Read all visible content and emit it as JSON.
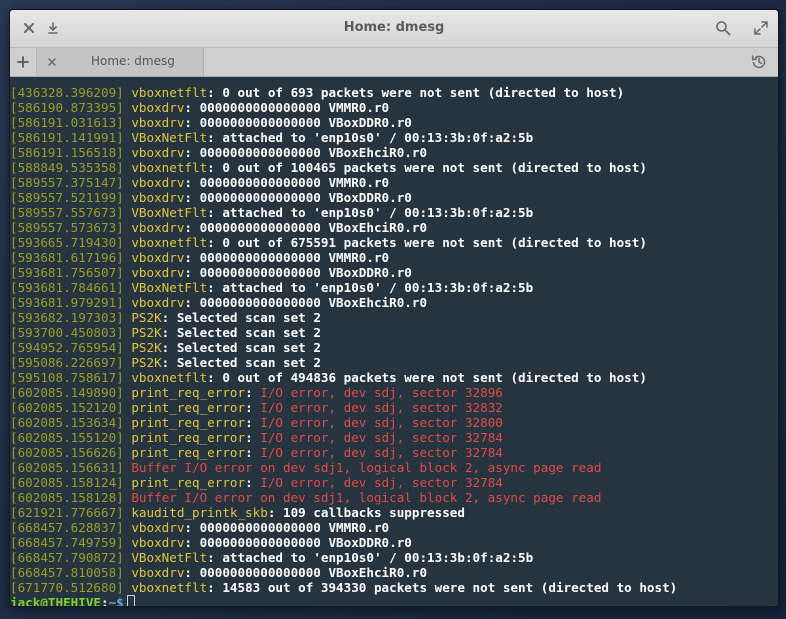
{
  "window": {
    "title": "Home: dmesg"
  },
  "tabs": [
    {
      "label": "Home: dmesg"
    }
  ],
  "icons": {
    "close": "close-icon",
    "download": "download-icon",
    "search": "search-icon",
    "maximize": "maximize-icon",
    "add_tab": "plus-icon",
    "tab_close": "close-icon",
    "history": "history-icon"
  },
  "colors": {
    "timestamp": "#9c9c29",
    "module": "#e0c63f",
    "message": "#ffffff",
    "error": "#e04a48",
    "prompt_user": "#7fd12e",
    "prompt_path": "#5fa8e0",
    "terminal_bg": "#26343f"
  },
  "terminal": {
    "lines": [
      {
        "ts": "[436328.396209]",
        "mod": "vboxnetflt",
        "sep": ": ",
        "msg": "0 out of 693 packets were not sent (directed to host)"
      },
      {
        "ts": "[586190.873395]",
        "mod": "vboxdrv",
        "sep": ": ",
        "msg": "0000000000000000 VMMR0.r0"
      },
      {
        "ts": "[586191.031613]",
        "mod": "vboxdrv",
        "sep": ": ",
        "msg": "0000000000000000 VBoxDDR0.r0"
      },
      {
        "ts": "[586191.141991]",
        "mod": "VBoxNetFlt",
        "sep": ": ",
        "msg": "attached to 'enp10s0' / 00:13:3b:0f:a2:5b"
      },
      {
        "ts": "[586191.156518]",
        "mod": "vboxdrv",
        "sep": ": ",
        "msg": "0000000000000000 VBoxEhciR0.r0"
      },
      {
        "ts": "[588849.535358]",
        "mod": "vboxnetflt",
        "sep": ": ",
        "msg": "0 out of 100465 packets were not sent (directed to host)"
      },
      {
        "ts": "[589557.375147]",
        "mod": "vboxdrv",
        "sep": ": ",
        "msg": "0000000000000000 VMMR0.r0"
      },
      {
        "ts": "[589557.521199]",
        "mod": "vboxdrv",
        "sep": ": ",
        "msg": "0000000000000000 VBoxDDR0.r0"
      },
      {
        "ts": "[589557.557673]",
        "mod": "VBoxNetFlt",
        "sep": ": ",
        "msg": "attached to 'enp10s0' / 00:13:3b:0f:a2:5b"
      },
      {
        "ts": "[589557.573673]",
        "mod": "vboxdrv",
        "sep": ": ",
        "msg": "0000000000000000 VBoxEhciR0.r0"
      },
      {
        "ts": "[593665.719430]",
        "mod": "vboxnetflt",
        "sep": ": ",
        "msg": "0 out of 675591 packets were not sent (directed to host)"
      },
      {
        "ts": "[593681.617196]",
        "mod": "vboxdrv",
        "sep": ": ",
        "msg": "0000000000000000 VMMR0.r0"
      },
      {
        "ts": "[593681.756507]",
        "mod": "vboxdrv",
        "sep": ": ",
        "msg": "0000000000000000 VBoxDDR0.r0"
      },
      {
        "ts": "[593681.784661]",
        "mod": "VBoxNetFlt",
        "sep": ": ",
        "msg": "attached to 'enp10s0' / 00:13:3b:0f:a2:5b"
      },
      {
        "ts": "[593681.979291]",
        "mod": "vboxdrv",
        "sep": ": ",
        "msg": "0000000000000000 VBoxEhciR0.r0"
      },
      {
        "ts": "[593682.197303]",
        "mod": "PS2K",
        "sep": ": ",
        "msg": "Selected scan set 2"
      },
      {
        "ts": "[593700.450803]",
        "mod": "PS2K",
        "sep": ": ",
        "msg": "Selected scan set 2"
      },
      {
        "ts": "[594952.765954]",
        "mod": "PS2K",
        "sep": ": ",
        "msg": "Selected scan set 2"
      },
      {
        "ts": "[595086.226697]",
        "mod": "PS2K",
        "sep": ": ",
        "msg": "Selected scan set 2"
      },
      {
        "ts": "[595108.758617]",
        "mod": "vboxnetflt",
        "sep": ": ",
        "msg": "0 out of 494836 packets were not sent (directed to host)"
      },
      {
        "ts": "[602085.149890]",
        "mod": "print_req_error",
        "sep": ": ",
        "err": "I/O error, dev sdj, sector 32896"
      },
      {
        "ts": "[602085.152120]",
        "mod": "print_req_error",
        "sep": ": ",
        "err": "I/O error, dev sdj, sector 32832"
      },
      {
        "ts": "[602085.153634]",
        "mod": "print_req_error",
        "sep": ": ",
        "err": "I/O error, dev sdj, sector 32800"
      },
      {
        "ts": "[602085.155120]",
        "mod": "print_req_error",
        "sep": ": ",
        "err": "I/O error, dev sdj, sector 32784"
      },
      {
        "ts": "[602085.156626]",
        "mod": "print_req_error",
        "sep": ": ",
        "err": "I/O error, dev sdj, sector 32784"
      },
      {
        "ts": "[602085.156631]",
        "err": "Buffer I/O error on dev sdj1, logical block 2, async page read"
      },
      {
        "ts": "[602085.158124]",
        "mod": "print_req_error",
        "sep": ": ",
        "err": "I/O error, dev sdj, sector 32784"
      },
      {
        "ts": "[602085.158128]",
        "err": "Buffer I/O error on dev sdj1, logical block 2, async page read"
      },
      {
        "ts": "[621921.776667]",
        "mod": "kauditd_printk_skb",
        "sep": ": ",
        "msg": "109 callbacks suppressed"
      },
      {
        "ts": "[668457.628837]",
        "mod": "vboxdrv",
        "sep": ": ",
        "msg": "0000000000000000 VMMR0.r0"
      },
      {
        "ts": "[668457.749759]",
        "mod": "vboxdrv",
        "sep": ": ",
        "msg": "0000000000000000 VBoxDDR0.r0"
      },
      {
        "ts": "[668457.790872]",
        "mod": "VBoxNetFlt",
        "sep": ": ",
        "msg": "attached to 'enp10s0' / 00:13:3b:0f:a2:5b"
      },
      {
        "ts": "[668457.810058]",
        "mod": "vboxdrv",
        "sep": ": ",
        "msg": "0000000000000000 VBoxEhciR0.r0"
      },
      {
        "ts": "[671770.512680]",
        "mod": "vboxnetflt",
        "sep": ": ",
        "msg": "14583 out of 394330 packets were not sent (directed to host)"
      }
    ],
    "prompt": {
      "user": "jack@THEHIVE",
      "sep": ":",
      "path": "~$"
    }
  }
}
